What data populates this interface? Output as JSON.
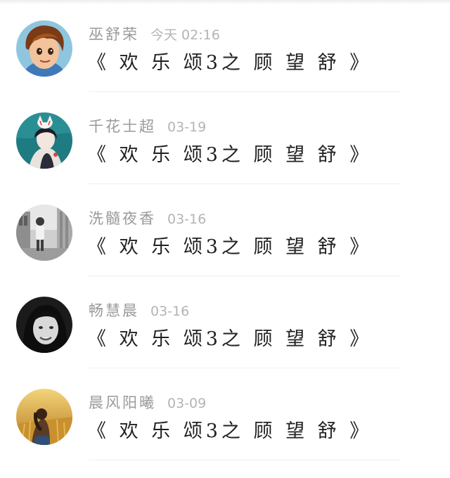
{
  "comments": [
    {
      "name": "巫舒荣",
      "time": "今天 02:16",
      "text": "《 欢 乐 颂3之 顾 望 舒 》",
      "avatar": "anime-boy-avatar"
    },
    {
      "name": "千花士超",
      "time": "03-19",
      "text": "《 欢 乐 颂3之 顾 望 舒 》",
      "avatar": "fox-mask-girl-avatar"
    },
    {
      "name": "洗髓夜香",
      "time": "03-16",
      "text": "《 欢 乐 颂3之 顾 望 舒 》",
      "avatar": "street-photo-avatar"
    },
    {
      "name": "畅慧晨",
      "time": "03-16",
      "text": "《 欢 乐 颂3之 顾 望 舒 》",
      "avatar": "bw-portrait-avatar"
    },
    {
      "name": "晨风阳曦",
      "time": "03-09",
      "text": "《 欢 乐 颂3之 顾 望 舒 》",
      "avatar": "wheat-field-avatar"
    }
  ],
  "colors": {
    "name": "#9a9a9a",
    "time": "#b4b4b4",
    "message": "#222222",
    "divider": "#efefef"
  }
}
